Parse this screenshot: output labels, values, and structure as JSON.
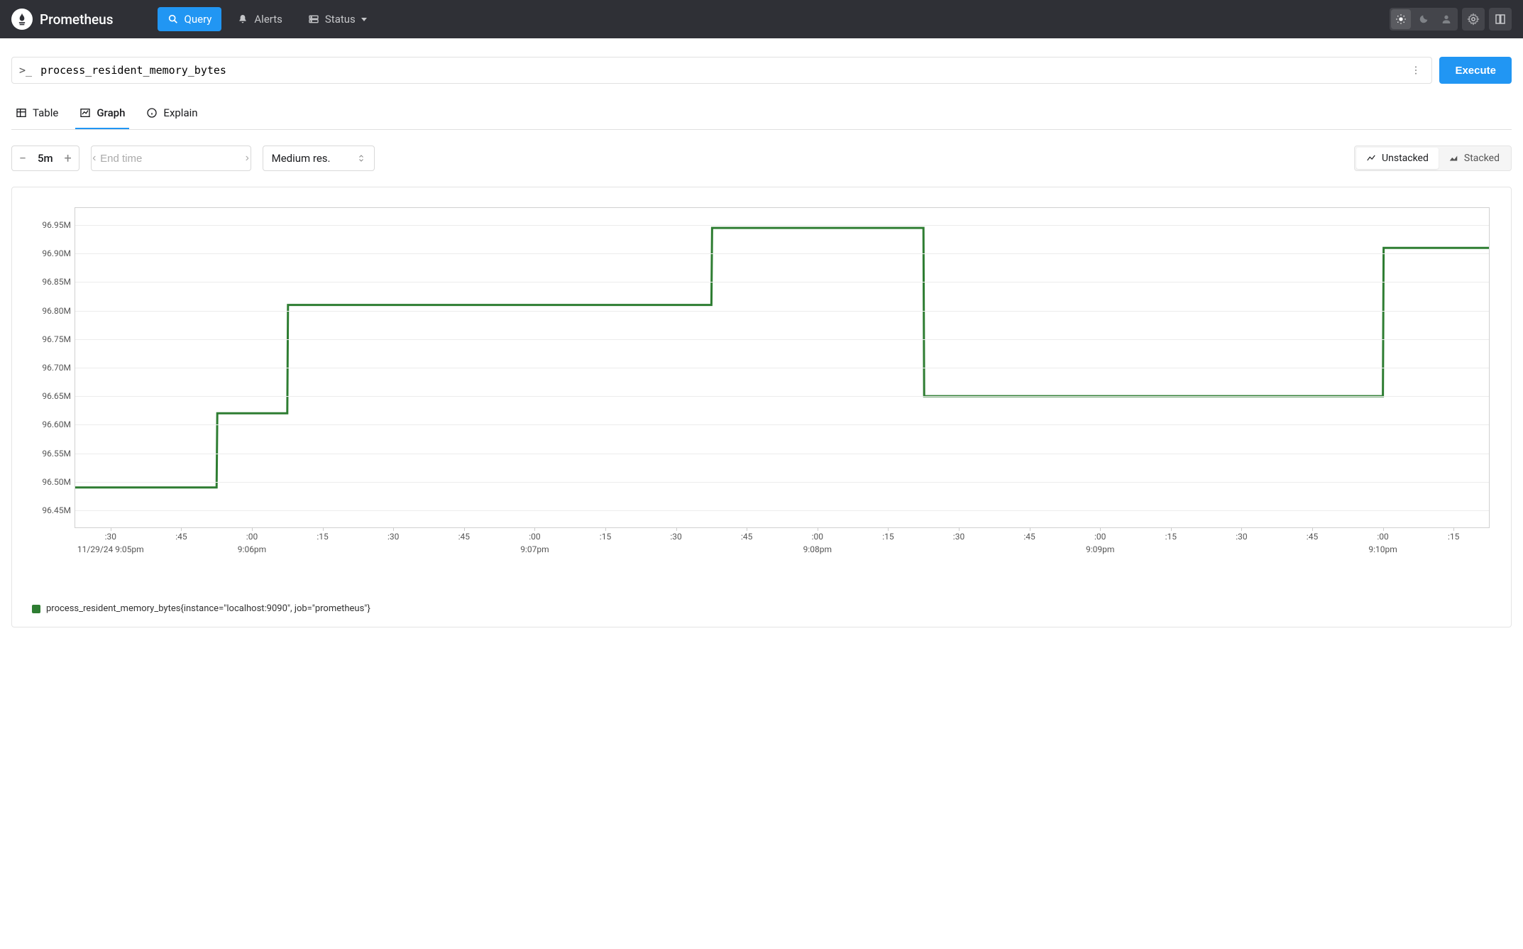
{
  "brand": "Prometheus",
  "nav": {
    "query": "Query",
    "alerts": "Alerts",
    "status": "Status"
  },
  "query": {
    "prompt": ">_",
    "expression": "process_resident_memory_bytes",
    "execute": "Execute"
  },
  "tabs": {
    "table": "Table",
    "graph": "Graph",
    "explain": "Explain"
  },
  "controls": {
    "range": "5m",
    "end_time_placeholder": "End time",
    "resolution": "Medium res.",
    "unstacked": "Unstacked",
    "stacked": "Stacked"
  },
  "legend": {
    "series_label": "process_resident_memory_bytes{instance=\"localhost:9090\", job=\"prometheus\"}",
    "color": "#2e7d32"
  },
  "chart_data": {
    "type": "line",
    "title": "",
    "xlabel": "",
    "ylabel": "",
    "y_ticks": [
      96.45,
      96.5,
      96.55,
      96.6,
      96.65,
      96.7,
      96.75,
      96.8,
      96.85,
      96.9,
      96.95
    ],
    "y_tick_labels": [
      "96.45M",
      "96.50M",
      "96.55M",
      "96.60M",
      "96.65M",
      "96.70M",
      "96.75M",
      "96.80M",
      "96.85M",
      "96.90M",
      "96.95M"
    ],
    "ylim": [
      96.42,
      96.98
    ],
    "x_ticks_minor": [
      ":30",
      ":45",
      ":00",
      ":15",
      ":30",
      ":45",
      ":00",
      ":15",
      ":30",
      ":45",
      ":00",
      ":15",
      ":30",
      ":45",
      ":00",
      ":15",
      ":30",
      ":45",
      ":00",
      ":15"
    ],
    "x_ticks_major": [
      "11/29/24 9:05pm",
      "9:06pm",
      "9:07pm",
      "9:08pm",
      "9:09pm",
      "9:10pm"
    ],
    "x": [
      0,
      2,
      2.01,
      3,
      3.01,
      9,
      9.01,
      12,
      12.01,
      18.5,
      18.51,
      20
    ],
    "values": [
      96.49,
      96.49,
      96.62,
      96.62,
      96.81,
      96.81,
      96.945,
      96.945,
      96.65,
      96.65,
      96.91,
      96.91
    ],
    "xlim": [
      0,
      20
    ]
  }
}
